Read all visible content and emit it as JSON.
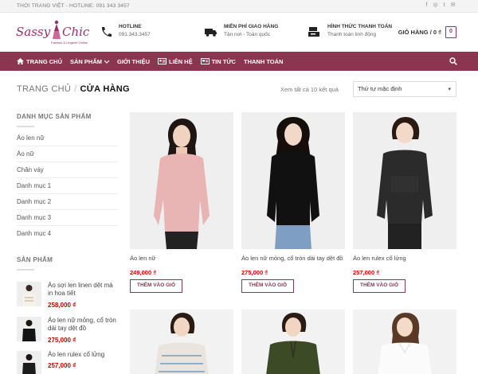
{
  "topbar": {
    "text": "THỜI TRANG VIỆT - HOTLINE: 091 343 3457",
    "social": [
      {
        "icon": "facebook-icon",
        "glyph": "f"
      },
      {
        "icon": "instagram-icon",
        "glyph": "◎"
      },
      {
        "icon": "twitter-icon",
        "glyph": "t"
      },
      {
        "icon": "email-icon",
        "glyph": "✉"
      }
    ]
  },
  "header": {
    "logo_left": "Sassy",
    "logo_right": "Chic",
    "logo_tagline": "Fashion & Lingerie Online",
    "hotline_title": "HOTLINE",
    "hotline_value": "091.343.3457",
    "shipping_title": "MIỄN PHÍ GIAO HÀNG",
    "shipping_sub": "Tận nơi - Toàn quốc",
    "payment_title": "HÌNH THỨC THANH TOÁN",
    "payment_sub": "Thanh toán linh động",
    "cart_label": "GIỎ HÀNG / 0 ₫",
    "cart_count": "0"
  },
  "nav": {
    "items": [
      {
        "label": "TRANG CHỦ",
        "icon": "home-icon"
      },
      {
        "label": "SẢN PHẨM",
        "icon": "chevron-down-icon"
      },
      {
        "label": "GIỚI THIỆU",
        "icon": ""
      },
      {
        "label": "LIÊN HỆ",
        "icon": "contact-card-icon"
      },
      {
        "label": "TIN TỨC",
        "icon": "newspaper-icon"
      },
      {
        "label": "THANH TOÁN",
        "icon": ""
      }
    ]
  },
  "breadcrumb": {
    "home": "TRANG CHỦ",
    "separator": "/",
    "current": "CỬA HÀNG"
  },
  "results": "Xem tất cả 10 kết quả",
  "sort": {
    "selected": "Thứ tự mặc định"
  },
  "sidebar": {
    "categories_heading": "DANH MỤC SẢN PHẨM",
    "categories": [
      "Áo len nữ",
      "Áo nữ",
      "Chân váy",
      "Danh mục 1",
      "Danh mục 2",
      "Danh mục 3",
      "Danh mục 4"
    ],
    "products_heading": "SẢN PHẨM",
    "products": [
      {
        "name": "Áo sợi len linen dệt mà in hoa tiết",
        "price": "258,000 ₫"
      },
      {
        "name": "Áo len nữ mỏng, cổ tròn dài tay dệt đồ",
        "price": "275,000 ₫"
      },
      {
        "name": "Áo len rulex cổ lửng",
        "price": "257,000 ₫"
      }
    ]
  },
  "products": [
    {
      "name": "Áo len nữ",
      "price": "249,000 ₫",
      "button": "THÊM VÀO GIỎ",
      "shirt": "#e8b4b4"
    },
    {
      "name": "Áo len nữ mỏng, cổ tròn dài tay dệt đồ",
      "price": "275,000 ₫",
      "button": "THÊM VÀO GIỎ",
      "shirt": "#111111"
    },
    {
      "name": "Áo len rulex cổ lửng",
      "price": "257,000 ₫",
      "button": "THÊM VÀO GIỎ",
      "shirt": "#1a1a1a"
    }
  ],
  "products_row2": [
    {
      "shirt": "#d9d4cf"
    },
    {
      "shirt": "#3d4a26"
    },
    {
      "shirt": "#f4f4f4"
    }
  ],
  "colors": {
    "brand": "#8b3650",
    "logo": "#9c2d6b",
    "price": "#cc0000"
  }
}
